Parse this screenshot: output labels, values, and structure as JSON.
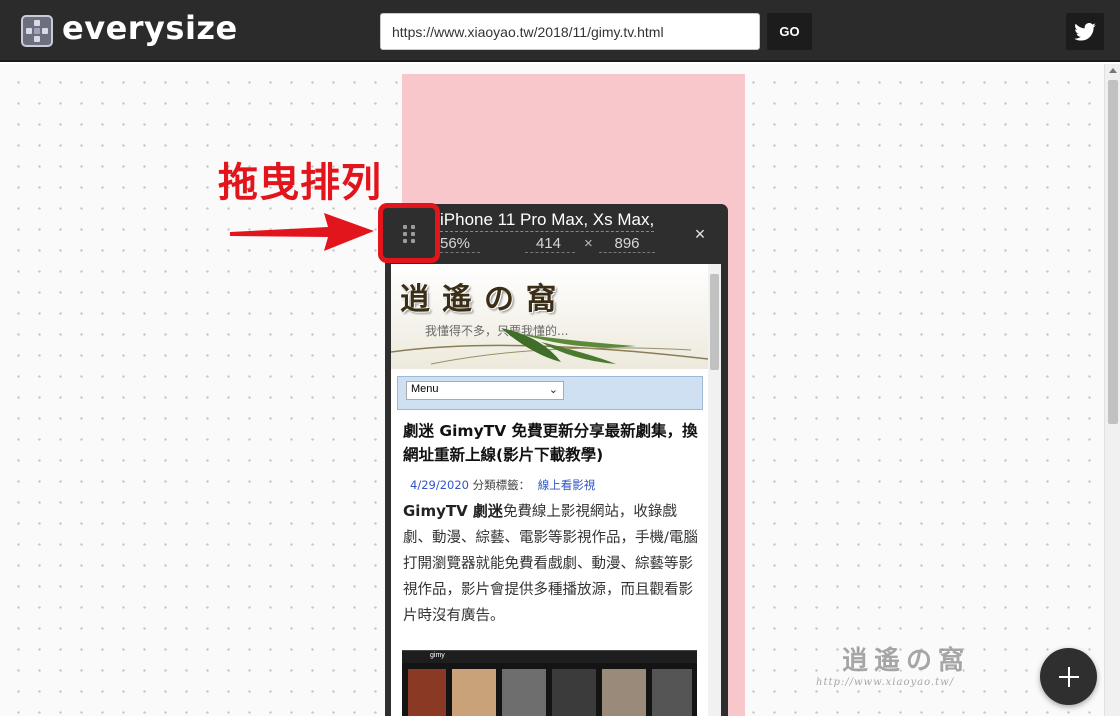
{
  "app": {
    "name": "everysize",
    "logo_icon": "grid-move-icon"
  },
  "toolbar": {
    "url_value": "https://www.xiaoyao.tw/2018/11/gimy.tv.html",
    "go_label": "GO",
    "twitter_icon": "twitter-icon"
  },
  "annotation": {
    "text": "拖曳排列",
    "color": "#e2141c",
    "arrow_icon": "red-arrow-icon"
  },
  "device": {
    "name": "iPhone 11 Pro Max, Xs Max,",
    "scale": "56%",
    "width": "414",
    "times": "×",
    "height": "896",
    "close_label": "×",
    "drag_icon": "drag-handle-icon"
  },
  "site": {
    "logo_text": "逍遙の窩",
    "slogan": "我懂得不多，只要我懂的...",
    "menu_label": "Menu",
    "menu_chevron": "⌄",
    "post_title": "劇迷 GimyTV 免費更新分享最新劇集，換網址重新上線(影片下載教學)",
    "post_date": "4/29/2020",
    "post_category_label": "分類標籤：",
    "post_category": "線上看影視",
    "post_lead": "GimyTV 劇迷",
    "post_body": "免費線上影視網站，收錄戲劇、動漫、綜藝、電影等影視作品，手機/電腦打開瀏覽器就能免費看戲劇、動漫、綜藝等影視作品，影片會提供多種播放源，而且觀看影片時沒有廣告。",
    "thumb_logo": "gimy"
  },
  "watermark": {
    "text": "逍遙の窩",
    "url": "http://www.xiaoyao.tw/"
  },
  "fab": {
    "label": "+",
    "icon": "plus-icon"
  },
  "colors": {
    "topbar": "#2b2b2b",
    "drop_zone": "#f7c7cc",
    "device_frame": "#2e2e2e",
    "accent_red": "#e2141c"
  }
}
